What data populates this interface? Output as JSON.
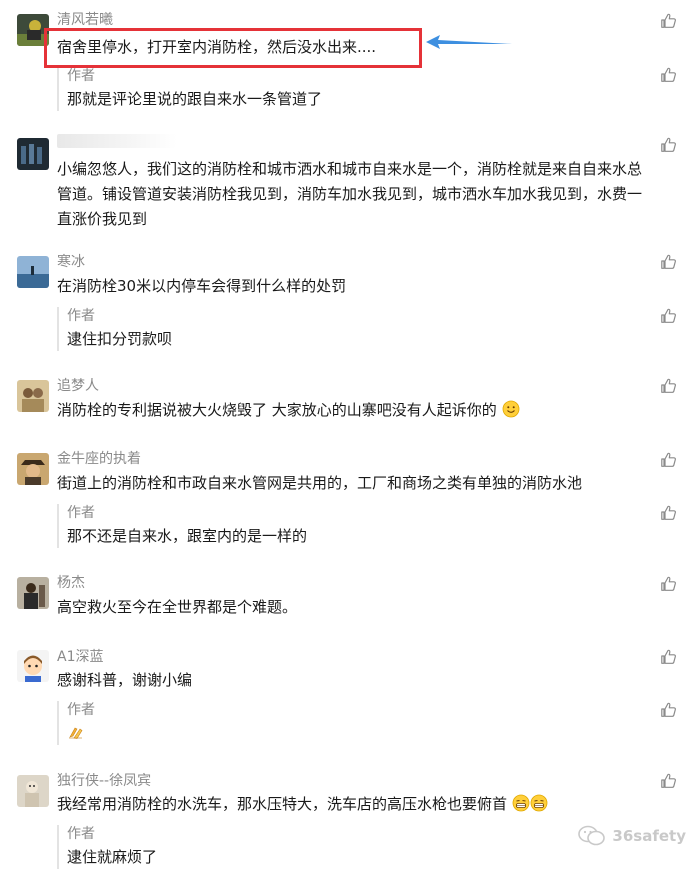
{
  "comments": [
    {
      "nickname": "清风若曦",
      "content": "宿舍里停水，打开室内消防栓，然后没水出来....",
      "reply": {
        "author": "作者",
        "content": "那就是评论里说的跟自来水一条管道了"
      }
    },
    {
      "nickname": "",
      "content": "小编忽悠人，我们这的消防栓和城市洒水和城市自来水是一个，消防栓就是来自自来水总管道。铺设管道安装消防栓我见到，消防车加水我见到，城市洒水车加水我见到，水费一直涨价我见到"
    },
    {
      "nickname": "寒冰",
      "content": "在消防栓30米以内停车会得到什么样的处罚",
      "reply": {
        "author": "作者",
        "content": "逮住扣分罚款呗"
      }
    },
    {
      "nickname": "追梦人",
      "content": "消防栓的专利据说被大火烧毁了 大家放心的山寨吧没有人起诉你的"
    },
    {
      "nickname": "金牛座的执着",
      "content": "街道上的消防栓和市政自来水管网是共用的，工厂和商场之类有单独的消防水池",
      "reply": {
        "author": "作者",
        "content": "那不还是自来水，跟室内的是一样的"
      }
    },
    {
      "nickname": "杨杰",
      "content": "高空救火至今在全世界都是个难题。"
    },
    {
      "nickname": "A1深蓝",
      "content": "感谢科普，谢谢小编",
      "reply": {
        "author": "作者",
        "content": ""
      }
    },
    {
      "nickname": "独行侠--徐凤宾",
      "content": "我经常用消防栓的水洗车，那水压特大，洗车店的高压水枪也要俯首",
      "reply": {
        "author": "作者",
        "content": "逮住就麻烦了"
      }
    }
  ],
  "watermark": "36safety",
  "colors": {
    "highlight": "#e53238",
    "arrow": "#3d8fe0",
    "nick": "#8a8a8a"
  }
}
